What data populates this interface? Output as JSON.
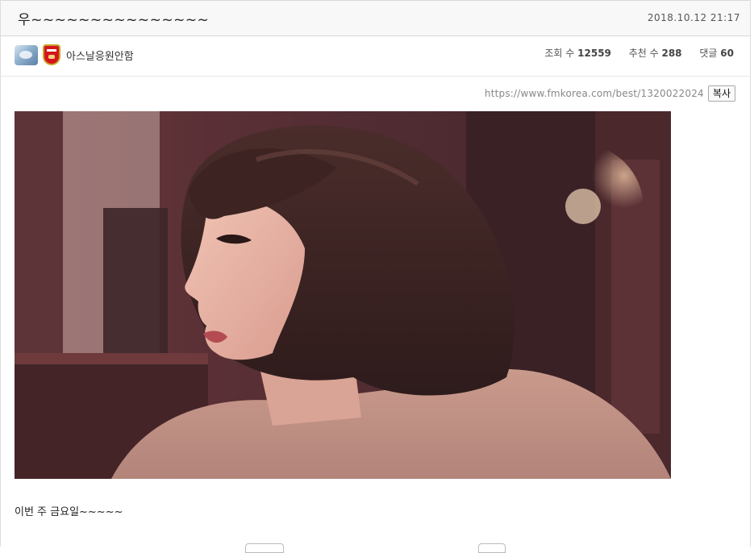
{
  "post": {
    "title": "우~~~~~~~~~~~~~~~",
    "date": "2018.10.12 21:17",
    "author": "아스날응원안함",
    "body_text": "이번 주 금요일~~~~~"
  },
  "stats": {
    "views_label": "조회 수",
    "views_value": "12559",
    "likes_label": "추천 수",
    "likes_value": "288",
    "comments_label": "댓글",
    "comments_value": "60"
  },
  "share": {
    "url": "https://www.fmkorea.com/best/1320022024",
    "copy_label": "복사"
  },
  "icons": {
    "level": "member-level-icon",
    "badge": "arsenal-club-badge-icon"
  }
}
